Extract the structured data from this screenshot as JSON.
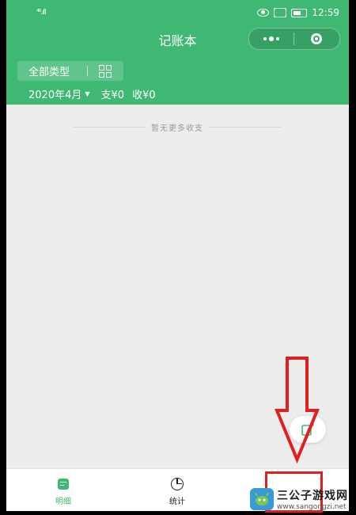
{
  "status_bar": {
    "signal": "⁴⁶.ıll",
    "time": "12:59"
  },
  "header": {
    "title": "记账本",
    "filter_label": "全部类型",
    "month": "2020年4月",
    "expense": "支¥0",
    "income": "收¥0"
  },
  "list": {
    "empty_text": "暂无更多收支"
  },
  "tabbar": {
    "tabs": [
      {
        "label": "明细",
        "color": "#3fb873"
      },
      {
        "label": "统计",
        "color": "#222222"
      }
    ]
  },
  "watermark": {
    "name": "三公子游戏网",
    "url": "www.sangongzi.net"
  },
  "colors": {
    "accent": "#3fb873",
    "background": "#ededed",
    "annotation": "#e02020"
  },
  "icons": [
    "eye-icon",
    "vibrate-icon",
    "battery-icon",
    "more-icon",
    "close-miniprogram-icon",
    "grid-icon",
    "caret-down-icon",
    "edit-icon",
    "detail-list-icon",
    "pie-chart-icon",
    "arrow-down-annotation-icon"
  ]
}
